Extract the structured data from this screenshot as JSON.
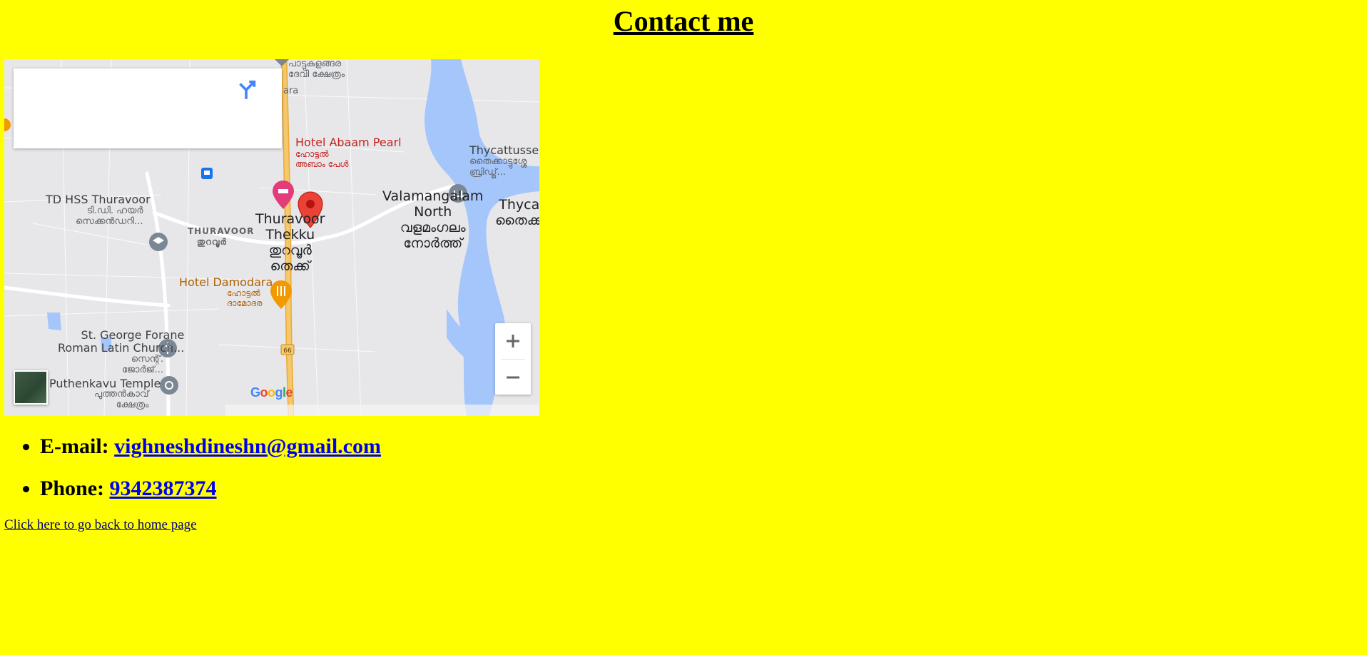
{
  "page": {
    "title": "Contact me",
    "background_color": "#ffff00"
  },
  "map": {
    "labels": {
      "temple_north": "പാട്ടുകുളങ്ങര\nദേവി ക്ഷേത്രം",
      "place_ara": "ara",
      "hotel_abaam": "Hotel Abaam Pearl",
      "hotel_abaam_ml": "ഹോട്ടൽ\nഅബാം പേൾ",
      "thycattussery": "Thycattusser",
      "thycattussery_ml": "തൈക്കാട്ടുശ്ശേ\nബ്രിഡ്ജ്...",
      "school": "TD HSS Thuravoor",
      "school_ml": "ടി.ഡി. ഹയർ\nസെക്കൻഡറി...",
      "thuravoor_caps": "THURAVOOR",
      "thuravoor_caps_ml": "തുറവൂർ",
      "thuravoor_thekku": "Thuravoor\nThekku\nതുറവൂർ\nതെക്ക്",
      "valamangalam": "Valamangalam\nNorth\nവളമംഗലം\nനോർത്ത്",
      "thyca_edge": "Thyca\nതൈക്ക",
      "hotel_damodara": "Hotel Damodara",
      "hotel_damodara_ml": "ഹോട്ടൽ\nദാമോദര",
      "church": "St. George Forane\nRoman Latin Church...",
      "church_ml": "സെന്റ്.\nജോർജ്...",
      "puthenkavu": "Puthenkavu Temple",
      "puthenkavu_ml": "പുത്തൻകാവ്\nക്ഷേത്രം",
      "highway_shield": "66"
    },
    "google_letters": [
      "G",
      "o",
      "o",
      "g",
      "l",
      "e"
    ],
    "colors": {
      "land": "#e7e7ea",
      "water": "#a5c6fb",
      "highway": "#f6c86a",
      "marker": "#ea4335"
    }
  },
  "contacts": [
    {
      "label": "E-mail: ",
      "value": "vighneshdineshn@gmail.com"
    },
    {
      "label": "Phone: ",
      "value": "9342387374"
    }
  ],
  "home_link": "Click here to go back to home page"
}
